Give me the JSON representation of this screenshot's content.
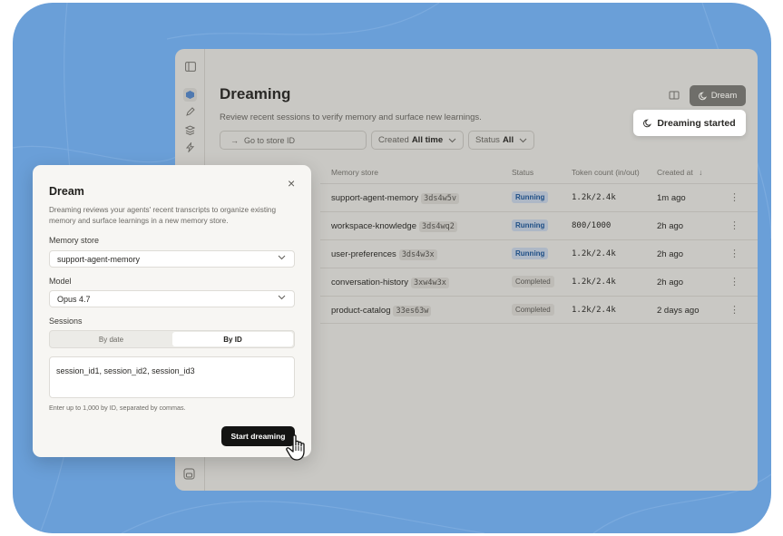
{
  "colors": {
    "backdrop": "#6a9fd8",
    "running": "#1f4f86",
    "primary_button": "#141413"
  },
  "rail": {
    "icons": [
      "sidebar-toggle-icon",
      "cube-icon",
      "pen-icon",
      "layers-icon",
      "bolt-icon",
      "profile-icon"
    ]
  },
  "header": {
    "title": "Dreaming",
    "subtitle": "Review recent sessions to verify memory and surface new learnings.",
    "dream_button": "Dream",
    "toast": "Dreaming started"
  },
  "filters": {
    "store_placeholder": "Go to store ID",
    "created_label": "Created",
    "created_value": "All time",
    "status_label": "Status",
    "status_value": "All"
  },
  "table": {
    "columns": {
      "memory_store": "Memory store",
      "status": "Status",
      "tokens": "Token count (in/out)",
      "created": "Created at"
    },
    "rows": [
      {
        "name": "support-agent-memory",
        "id": "3ds4w5v",
        "status": "Running",
        "tokens": "1.2k/2.4k",
        "created": "1m ago"
      },
      {
        "name": "workspace-knowledge",
        "id": "3ds4wq2",
        "status": "Running",
        "tokens": "800/1000",
        "created": "2h ago"
      },
      {
        "name": "user-preferences",
        "id": "3ds4w3x",
        "status": "Running",
        "tokens": "1.2k/2.4k",
        "created": "2h ago"
      },
      {
        "name": "conversation-history",
        "id": "3xw4w3x",
        "status": "Completed",
        "tokens": "1.2k/2.4k",
        "created": "2h ago"
      },
      {
        "name": "product-catalog",
        "id": "33es63w",
        "status": "Completed",
        "tokens": "1.2k/2.4k",
        "created": "2 days ago"
      }
    ]
  },
  "modal": {
    "title": "Dream",
    "description": "Dreaming reviews your agents' recent transcripts to organize existing memory and surface learnings in a new memory store.",
    "memory_store_label": "Memory store",
    "memory_store_value": "support-agent-memory",
    "model_label": "Model",
    "model_value": "Opus 4.7",
    "sessions_label": "Sessions",
    "tab_by_date": "By date",
    "tab_by_id": "By ID",
    "sessions_value": "session_id1, session_id2, session_id3",
    "help": "Enter up to 1,000 by ID, separated by commas.",
    "submit": "Start dreaming"
  }
}
